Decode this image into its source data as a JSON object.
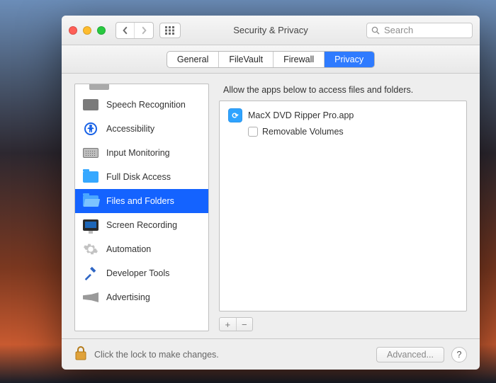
{
  "window": {
    "title": "Security & Privacy"
  },
  "search": {
    "placeholder": "Search"
  },
  "tabs": [
    "General",
    "FileVault",
    "Firewall",
    "Privacy"
  ],
  "active_tab": "Privacy",
  "sidebar": {
    "items": [
      {
        "label": "Speech Recognition",
        "icon": "speech-recognition-icon"
      },
      {
        "label": "Accessibility",
        "icon": "accessibility-icon"
      },
      {
        "label": "Input Monitoring",
        "icon": "keyboard-icon"
      },
      {
        "label": "Full Disk Access",
        "icon": "folder-icon"
      },
      {
        "label": "Files and Folders",
        "icon": "folder-open-icon"
      },
      {
        "label": "Screen Recording",
        "icon": "display-icon"
      },
      {
        "label": "Automation",
        "icon": "gear-icon"
      },
      {
        "label": "Developer Tools",
        "icon": "hammer-icon"
      },
      {
        "label": "Advertising",
        "icon": "megaphone-icon"
      }
    ],
    "selected_index": 4
  },
  "right": {
    "hint": "Allow the apps below to access files and folders.",
    "apps": [
      {
        "name": "MacX DVD Ripper Pro.app",
        "permissions": [
          {
            "label": "Removable Volumes",
            "checked": false
          }
        ]
      }
    ],
    "add_label": "+",
    "remove_label": "−"
  },
  "footer": {
    "lock_hint": "Click the lock to make changes.",
    "advanced_label": "Advanced...",
    "help_label": "?"
  }
}
